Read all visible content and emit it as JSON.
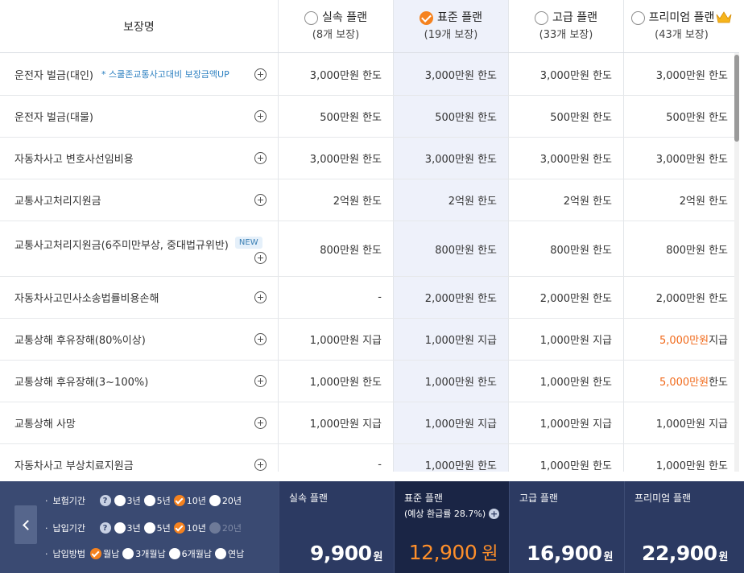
{
  "header": {
    "coverage_label": "보장명",
    "plans": [
      {
        "name": "실속 플랜",
        "count": "(8개 보장)",
        "selected": false
      },
      {
        "name": "표준 플랜",
        "count": "(19개 보장)",
        "selected": true
      },
      {
        "name": "고급 플랜",
        "count": "(33개 보장)",
        "selected": false
      },
      {
        "name": "프리미엄 플랜",
        "count": "(43개 보장)",
        "selected": false
      }
    ]
  },
  "rows": [
    {
      "name": "운전자 벌금(대인)",
      "sub": "* 스쿨존교통사고대비 보장금액UP",
      "v": [
        "3,000만원 한도",
        "3,000만원 한도",
        "3,000만원 한도",
        "3,000만원 한도"
      ]
    },
    {
      "name": "운전자 벌금(대물)",
      "v": [
        "500만원 한도",
        "500만원 한도",
        "500만원 한도",
        "500만원 한도"
      ]
    },
    {
      "name": "자동차사고 변호사선임비용",
      "v": [
        "3,000만원 한도",
        "3,000만원 한도",
        "3,000만원 한도",
        "3,000만원 한도"
      ]
    },
    {
      "name": "교통사고처리지원금",
      "v": [
        "2억원 한도",
        "2억원 한도",
        "2억원 한도",
        "2억원 한도"
      ]
    },
    {
      "name": "교통사고처리지원금(6주미만부상, 중대법규위반)",
      "badge": "NEW",
      "v": [
        "800만원 한도",
        "800만원 한도",
        "800만원 한도",
        "800만원 한도"
      ]
    },
    {
      "name": "자동차사고민사소송법률비용손해",
      "v": [
        "-",
        "2,000만원 한도",
        "2,000만원 한도",
        "2,000만원 한도"
      ]
    },
    {
      "name": "교통상해 후유장해(80%이상)",
      "v": [
        "1,000만원 지급",
        "1,000만원 지급",
        "1,000만원 지급",
        "5,000만원 지급"
      ],
      "hl": "5,000만원",
      "hl_rest": " 지급"
    },
    {
      "name": "교통상해 후유장해(3~100%)",
      "v": [
        "1,000만원 한도",
        "1,000만원 한도",
        "1,000만원 한도",
        "5,000만원 한도"
      ],
      "hl": "5,000만원",
      "hl_rest": " 한도"
    },
    {
      "name": "교통상해 사망",
      "v": [
        "1,000만원 지급",
        "1,000만원 지급",
        "1,000만원 지급",
        "1,000만원 지급"
      ]
    },
    {
      "name": "자동차사고 부상치료지원금",
      "v": [
        "-",
        "1,000만원 한도",
        "1,000만원 한도",
        "1,000만원 한도"
      ]
    }
  ],
  "options": {
    "insurance_period": {
      "label": "보험기간",
      "choices": [
        "3년",
        "5년",
        "10년",
        "20년"
      ],
      "selected": "10년"
    },
    "payment_period": {
      "label": "납입기간",
      "choices": [
        "3년",
        "5년",
        "10년",
        "20년"
      ],
      "selected": "10년",
      "disabled": [
        "20년"
      ]
    },
    "payment_method": {
      "label": "납입방법",
      "choices": [
        "월납",
        "3개월납",
        "6개월납",
        "연납"
      ],
      "selected": "월납"
    },
    "bullet": "·"
  },
  "prices": [
    {
      "title": "실속 플랜",
      "amount": "9,900",
      "unit": "원",
      "selected": false
    },
    {
      "title": "표준 플랜",
      "refund": "(예상 환급률 28.7%)",
      "amount": "12,900",
      "unit": "원",
      "selected": true
    },
    {
      "title": "고급 플랜",
      "amount": "16,900",
      "unit": "원",
      "selected": false
    },
    {
      "title": "프리미엄 플랜",
      "amount": "22,900",
      "unit": "원",
      "selected": false
    }
  ],
  "colors": {
    "accent": "#f5821f",
    "highlight": "#f16a1b",
    "nav_bg": "#2c3a62",
    "selected_col": "#eef1fa"
  }
}
